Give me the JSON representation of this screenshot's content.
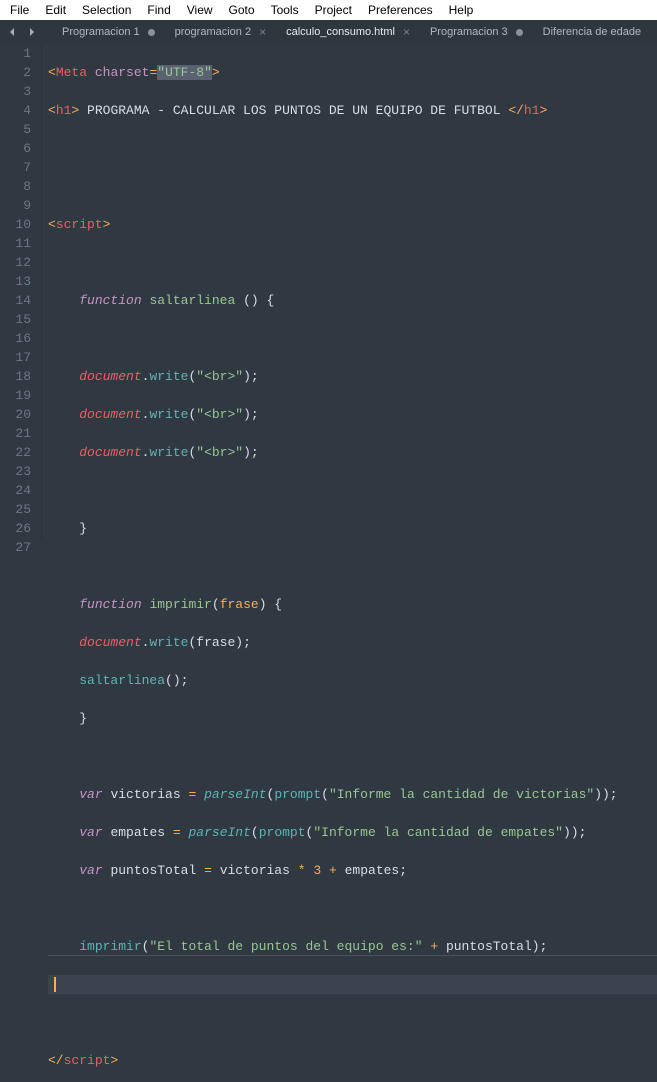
{
  "menu": {
    "file": "File",
    "edit": "Edit",
    "selection": "Selection",
    "find": "Find",
    "view": "View",
    "goto": "Goto",
    "tools": "Tools",
    "project": "Project",
    "preferences": "Preferences",
    "help": "Help"
  },
  "tabs": [
    {
      "label": "Programacion 1",
      "dirty": true
    },
    {
      "label": "programacion 2",
      "dirty": false
    },
    {
      "label": "calculo_consumo.html",
      "dirty": false
    },
    {
      "label": "Programacion 3",
      "dirty": true
    },
    {
      "label": "Diferencia de edade",
      "dirty": false
    }
  ],
  "lines": [
    "1",
    "2",
    "3",
    "4",
    "5",
    "6",
    "7",
    "8",
    "9",
    "10",
    "11",
    "12",
    "13",
    "14",
    "15",
    "16",
    "17",
    "18",
    "19",
    "20",
    "21",
    "22",
    "23",
    "24",
    "25",
    "26",
    "27"
  ],
  "src": {
    "meta_tag": "Meta",
    "charset_attr": "charset",
    "eq": "=",
    "utf8": "\"UTF-8\"",
    "h1": "h1",
    "title_text": " PROGRAMA - CALCULAR LOS PUNTOS DE UN EQUIPO DE FUTBOL ",
    "script_tag": "script",
    "fn_kw": "function",
    "fn1": "saltarlinea",
    "fn2": "imprimir",
    "param_frase": "frase",
    "doc": "document",
    "write": "write",
    "br": "\"<br>\"",
    "call_saltar": "saltarlinea",
    "var_kw": "var",
    "victorias": "victorias",
    "empates": "empates",
    "puntosTotal": "puntosTotal",
    "parseInt": "parseInt",
    "prompt": "prompt",
    "prompt1": "\"Informe la cantidad de victorias\"",
    "prompt2": "\"Informe la cantidad de empates\"",
    "three": "3",
    "plus": "+",
    "star": "*",
    "imp_call": "ímprimir",
    "result_str": "\"El total de puntos del equipo es:\""
  }
}
